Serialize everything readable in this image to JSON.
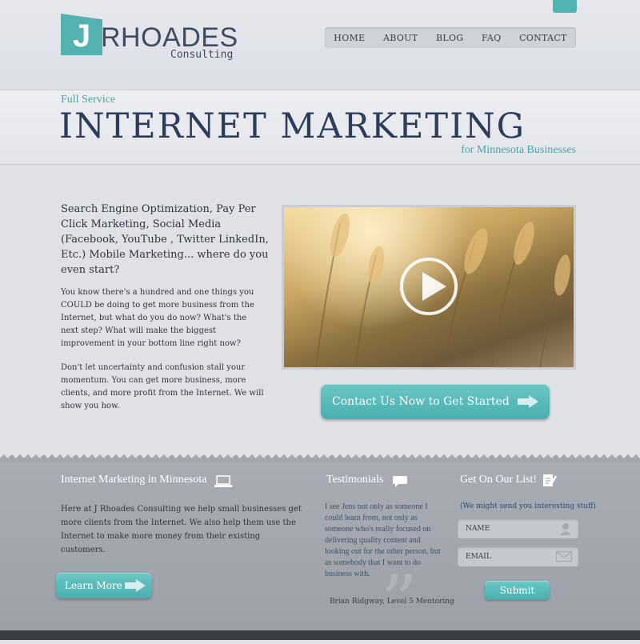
{
  "colors": {
    "accent": "#4fb3b1",
    "title_navy": "#2c3d5c",
    "footer_gray": "#a2a6ae"
  },
  "logo": {
    "initial": "J",
    "name": "RHOADES",
    "sub": "Consulting"
  },
  "nav": {
    "items": [
      "HOME",
      "ABOUT",
      "BLOG",
      "FAQ",
      "CONTACT"
    ]
  },
  "hero": {
    "pre": "Full Service",
    "title": "INTERNET MARKETING",
    "post": "for Minnesota Businesses"
  },
  "intro": {
    "lead": "Search Engine Optimization, Pay Per Click Marketing, Social Media (Facebook, YouTube , Twitter LinkedIn, Etc.) Mobile Marketing... where do you even start?",
    "para1": "You know there's a hundred and one things you COULD be doing to get more business from the Internet, but what do you do now?  What's the next step? What will make the biggest improvement in your bottom line right now?",
    "para2": "Don't let uncertainty and confusion stall your momentum.  You can get more business, more clients, and more profit from the Internet.  We will show you how."
  },
  "video": {
    "play_icon": "play-circle-icon"
  },
  "cta": {
    "label": "Contact Us Now to Get Started"
  },
  "imm": {
    "title": "Internet Marketing in Minnesota",
    "icon": "laptop-icon",
    "body": "Here at J Rhoades Consulting we help small businesses get more clients from the Internet. We also help them use the Internet to make more money from their existing customers.",
    "button": "Learn More"
  },
  "testimonials": {
    "title": "Testimonials",
    "icon": "speech-bubble-icon",
    "quote": "I see Jens not only as someone I could learn from, not only as someone who's really focused on delivering quality content and looking out for the other person, but as somebody that I want to do business with.",
    "author": "Brian Ridgway, Level 5 Mentoring"
  },
  "signup": {
    "title": "Get On Our List!",
    "icon": "notepad-pencil-icon",
    "note": "(We might send you interesting stuff)",
    "name_placeholder": "NAME",
    "email_placeholder": "EMAIL",
    "submit": "Submit"
  }
}
